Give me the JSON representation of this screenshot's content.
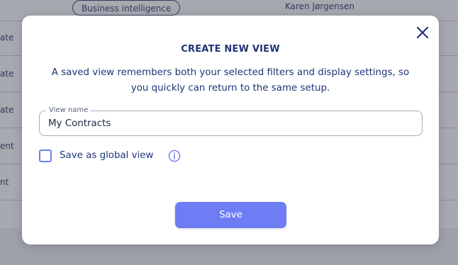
{
  "background": {
    "first_row": {
      "tag": "Business intelligence",
      "person": "Karen Jørgensen"
    },
    "row_fragments": [
      "ate",
      "ate",
      "ate",
      "ent",
      "nt"
    ]
  },
  "modal": {
    "title": "CREATE NEW VIEW",
    "description": "A saved view remembers both your selected filters and display settings, so you quickly can return to the same setup.",
    "view_name": {
      "label": "View name",
      "value": "My Contracts"
    },
    "global_checkbox": {
      "label": "Save as global view",
      "checked": false
    },
    "save_label": "Save",
    "icons": {
      "close": "close-icon",
      "info": "info-icon"
    },
    "colors": {
      "accent": "#6e7df3",
      "title": "#1e3476"
    }
  }
}
